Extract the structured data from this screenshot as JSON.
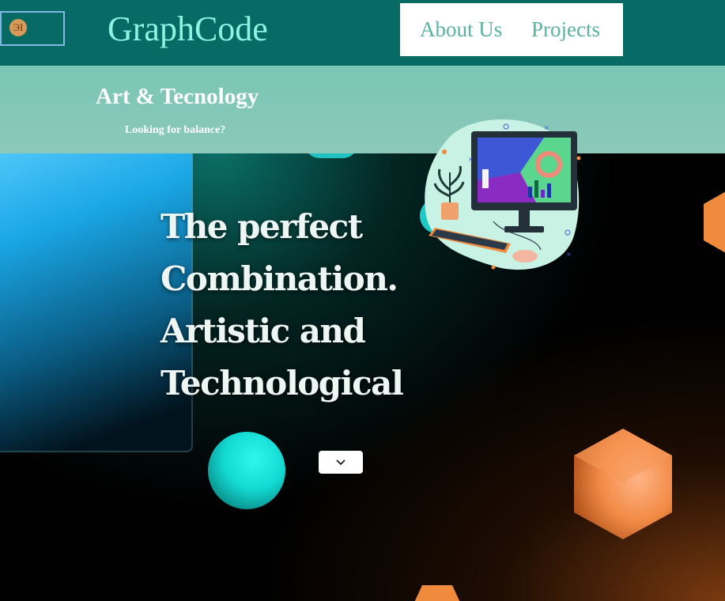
{
  "header": {
    "logo_text": "ЭІ",
    "brand": "GraphCode",
    "nav": [
      {
        "label": "About Us"
      },
      {
        "label": "Projects"
      }
    ]
  },
  "band": {
    "title": "Art & Tecnology",
    "subtitle": "Looking for balance?"
  },
  "hero": {
    "headline": [
      "The perfect",
      "Combination.",
      "Artistic and",
      "Technological"
    ],
    "scroll_icon": "chevron-down-icon"
  },
  "colors": {
    "topbar": "#086a64",
    "band": "#7fc6b6",
    "brand": "#8ef3e3",
    "nav_text": "#5cb2a2",
    "accent_cyan": "#12d9d1",
    "accent_orange": "#f08a3c"
  }
}
